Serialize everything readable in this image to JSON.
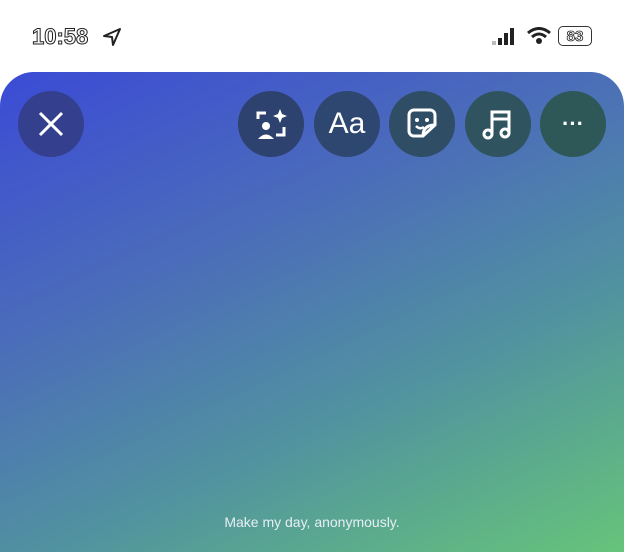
{
  "status": {
    "time": "10:58",
    "battery": "83"
  },
  "toolbar": {
    "close": "close",
    "text_label": "Aa",
    "more": "···"
  },
  "caption": "Make my day, anonymously.",
  "colors": {
    "gradient_start": "#3b4bd6",
    "gradient_end": "#66c47a",
    "button_bg": "#2f3f6a"
  }
}
